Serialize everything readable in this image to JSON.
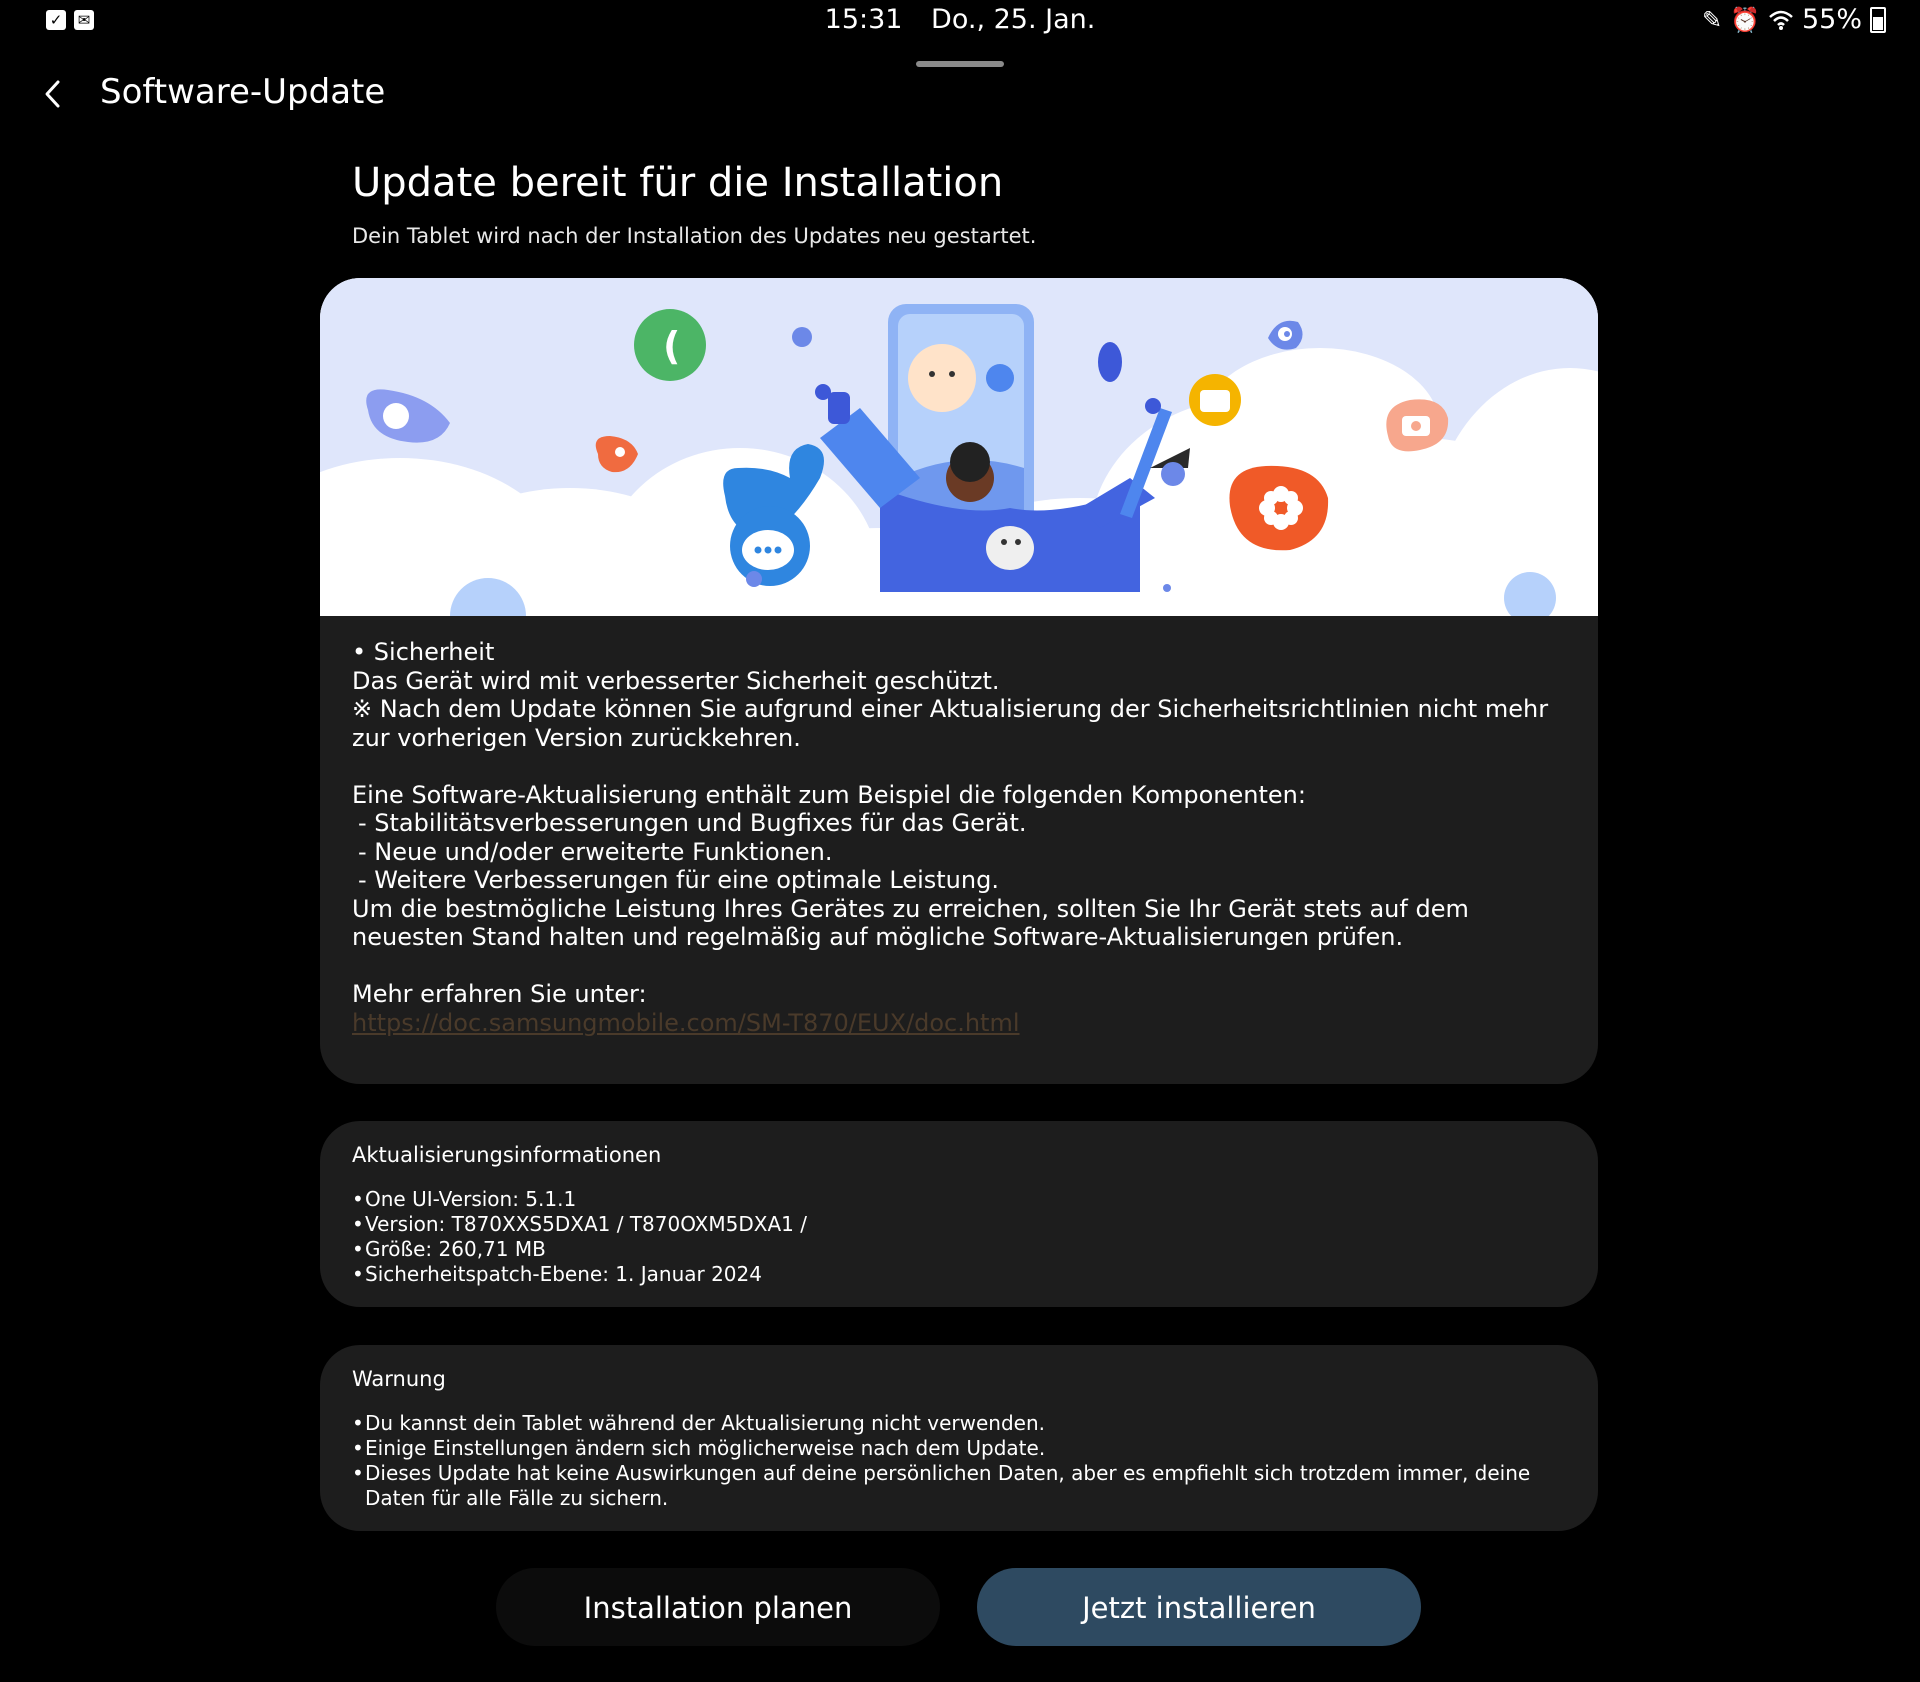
{
  "status_bar": {
    "time": "15:31",
    "date": "Do., 25. Jan.",
    "battery": "55%",
    "left_icons": [
      "check-notification-icon",
      "mail-icon"
    ],
    "right_icons": [
      "pen-icon",
      "alarm-icon",
      "wifi-icon",
      "battery-icon"
    ]
  },
  "header": {
    "title": "Software-Update"
  },
  "main": {
    "heading": "Update bereit für die Installation",
    "subheading": "Dein Tablet wird nach der Installation des Updates neu gestartet."
  },
  "release_notes": {
    "paragraphs": [
      "• Sicherheit",
      "Das Gerät wird mit verbesserter Sicherheit geschützt.",
      "※ Nach dem Update können Sie aufgrund einer Aktualisierung der Sicherheitsrichtlinien nicht mehr zur vorherigen Version zurückkehren.",
      "",
      "Eine Software-Aktualisierung enthält zum Beispiel die folgenden Komponenten:",
      " - Stabilitätsverbesserungen und Bugfixes für das Gerät.",
      " - Neue und/oder erweiterte Funktionen.",
      " - Weitere Verbesserungen für eine optimale Leistung.",
      "Um die bestmögliche Leistung Ihres Gerätes zu erreichen, sollten Sie Ihr Gerät stets auf dem neuesten Stand halten und regelmäßig auf mögliche Software-Aktualisierungen prüfen.",
      "",
      "Mehr erfahren Sie unter:"
    ],
    "link": "https://doc.samsungmobile.com/SM-T870/EUX/doc.html"
  },
  "update_info": {
    "title": "Aktualisierungsinformationen",
    "items": [
      "One UI-Version: 5.1.1",
      "Version: T870XXS5DXA1 / T870OXM5DXA1 /",
      "Größe: 260,71 MB",
      "Sicherheitspatch-Ebene: 1. Januar 2024"
    ]
  },
  "warning": {
    "title": "Warnung",
    "items": [
      "Du kannst dein Tablet während der Aktualisierung nicht verwenden.",
      "Einige Einstellungen ändern sich möglicherweise nach dem Update.",
      "Dieses Update hat keine Auswirkungen auf deine persönlichen Daten, aber es empfiehlt sich trotzdem immer, deine Daten für alle Fälle zu sichern."
    ]
  },
  "buttons": {
    "schedule": "Installation planen",
    "install_now": "Jetzt installieren"
  },
  "colors": {
    "background": "#000000",
    "card": "#1d1d1d",
    "install_button": "#2e4a61",
    "schedule_button": "#0c0c0c",
    "link": "#4a3a2a"
  }
}
